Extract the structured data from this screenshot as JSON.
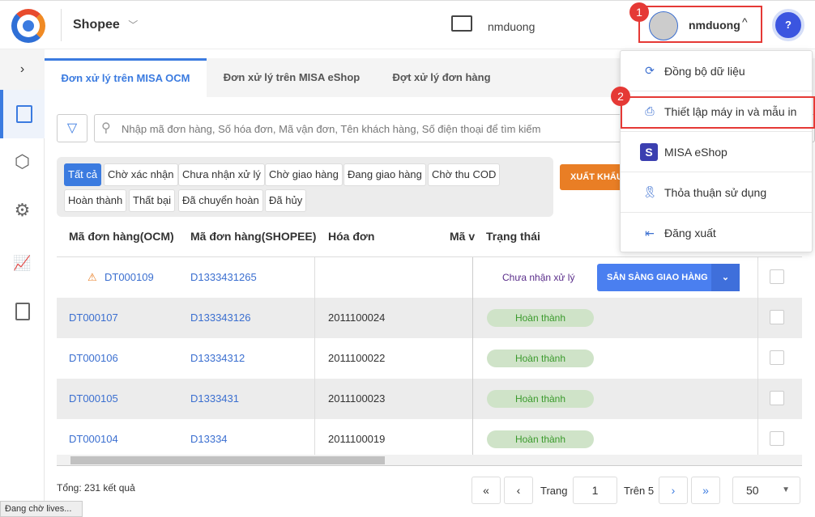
{
  "header": {
    "shop": "Shopee",
    "store_name": "nmduong",
    "user": "nmduong"
  },
  "tabs": [
    "Đơn xử lý trên MISA OCM",
    "Đơn xử lý trên MISA eShop",
    "Đợt xử lý đơn hàng"
  ],
  "search": {
    "placeholder": "Nhập mã đơn hàng, Số hóa đơn, Mã vận đơn, Tên khách hàng, Số điện thoại để tìm kiếm"
  },
  "filters": [
    "Tất cả",
    "Chờ xác nhận",
    "Chưa nhận xử lý",
    "Chờ giao hàng",
    "Đang giao hàng",
    "Chờ thu COD",
    "Hoàn thành",
    "Thất bại",
    "Đã chuyển hoàn",
    "Đã hủy"
  ],
  "export_label": "XUẤT KHẨU",
  "columns": [
    "Mã đơn hàng(OCM)",
    "Mã đơn hàng(SHOPEE)",
    "Hóa đơn",
    "Mã v",
    "Trạng thái"
  ],
  "rows": [
    {
      "ocm": "DT000109",
      "shopee": "D1333431265",
      "invoice": "",
      "status": "Chưa nhận xử lý",
      "action": "SẴN SÀNG GIAO HÀNG"
    },
    {
      "ocm": "DT000107",
      "shopee": "D133343126",
      "invoice": "2011100024",
      "status": "Hoàn thành"
    },
    {
      "ocm": "DT000106",
      "shopee": "D13334312",
      "invoice": "2011100022",
      "status": "Hoàn thành"
    },
    {
      "ocm": "DT000105",
      "shopee": "D1333431",
      "invoice": "2011100023",
      "status": "Hoàn thành"
    },
    {
      "ocm": "DT000104",
      "shopee": "D13334",
      "invoice": "2011100019",
      "status": "Hoàn thành"
    }
  ],
  "footer": {
    "total": "Tổng: 231 kết quả",
    "page_label": "Trang",
    "page": "1",
    "of": "Trên 5",
    "page_size": "50"
  },
  "menu": [
    "Đồng bộ dữ liệu",
    "Thiết lập máy in và mẫu in",
    "MISA eShop",
    "Thỏa thuận sử dụng",
    "Đăng xuất"
  ],
  "callouts": [
    "1",
    "2"
  ],
  "status_bar": "Đang chờ lives..."
}
